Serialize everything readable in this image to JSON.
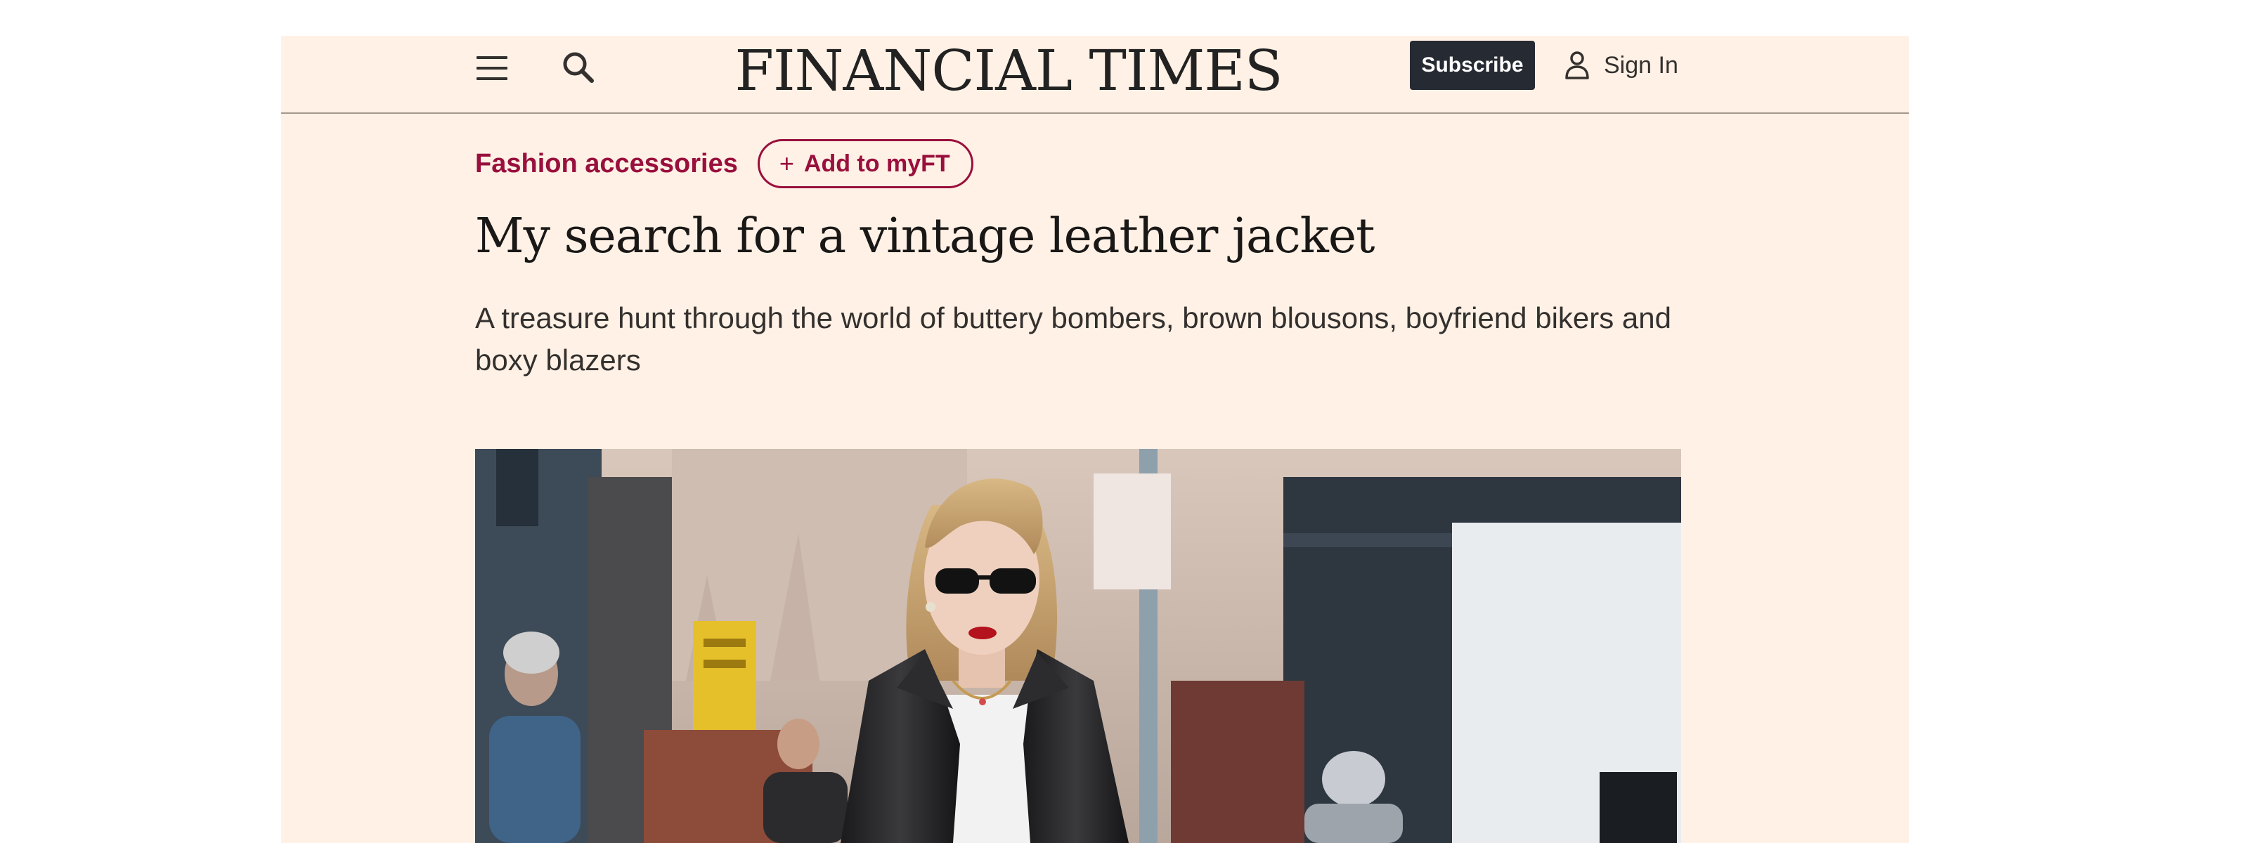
{
  "header": {
    "menu_icon": "hamburger-menu-icon",
    "search_icon": "search-icon",
    "masthead": "FINANCIAL TIMES",
    "subscribe_label": "Subscribe",
    "signin_icon": "user-icon",
    "signin_label": "Sign In"
  },
  "article": {
    "topic": "Fashion accessories",
    "myft_label": "Add to myFT",
    "myft_icon": "plus-icon",
    "headline": "My search for a vintage leather jacket",
    "standfirst": "A treasure hunt through the world of buttery bombers, brown blousons, boyfriend bikers and boxy blazers"
  },
  "colors": {
    "page_background": "#fff1e5",
    "brand_claret": "#990f3d",
    "subscribe_background": "#262a33",
    "text_dark": "#33302e"
  }
}
